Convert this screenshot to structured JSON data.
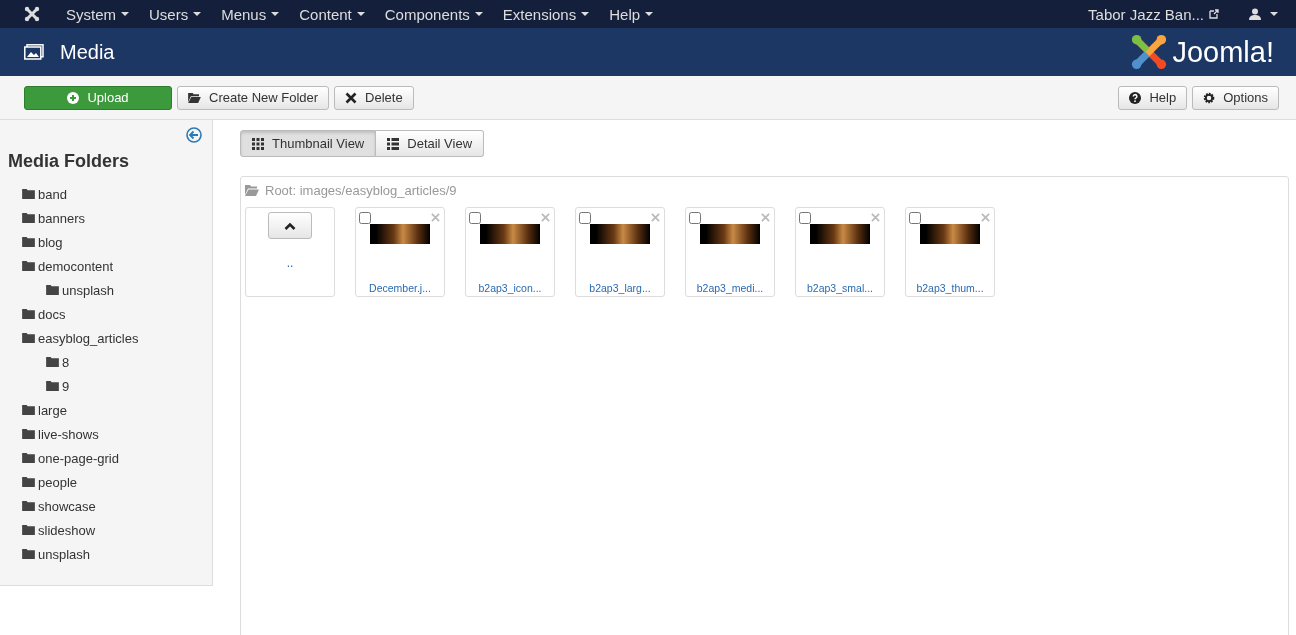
{
  "top_menu": [
    {
      "label": "System"
    },
    {
      "label": "Users"
    },
    {
      "label": "Menus"
    },
    {
      "label": "Content"
    },
    {
      "label": "Components"
    },
    {
      "label": "Extensions"
    },
    {
      "label": "Help"
    }
  ],
  "site_link": "Tabor Jazz Ban...",
  "header": {
    "title": "Media",
    "logo_text": "Joomla!"
  },
  "toolbar": {
    "left": [
      {
        "label": "Upload",
        "kind": "upload"
      },
      {
        "label": "Create New Folder",
        "kind": "folder"
      },
      {
        "label": "Delete",
        "kind": "delete"
      }
    ],
    "right": [
      {
        "label": "Help",
        "kind": "help"
      },
      {
        "label": "Options",
        "kind": "options"
      }
    ]
  },
  "sidebar": {
    "title": "Media Folders",
    "folders": [
      {
        "name": "band"
      },
      {
        "name": "banners"
      },
      {
        "name": "blog"
      },
      {
        "name": "democontent",
        "children": [
          {
            "name": "unsplash"
          }
        ]
      },
      {
        "name": "docs"
      },
      {
        "name": "easyblog_articles",
        "children": [
          {
            "name": "8"
          },
          {
            "name": "9"
          }
        ]
      },
      {
        "name": "large"
      },
      {
        "name": "live-shows"
      },
      {
        "name": "one-page-grid"
      },
      {
        "name": "people"
      },
      {
        "name": "showcase"
      },
      {
        "name": "slideshow"
      },
      {
        "name": "unsplash"
      }
    ]
  },
  "view_tabs": [
    {
      "label": "Thumbnail View",
      "kind": "grid",
      "selected": true
    },
    {
      "label": "Detail View",
      "kind": "list",
      "selected": false
    }
  ],
  "path": "Root: images/easyblog_articles/9",
  "up_label": "..",
  "files": [
    {
      "name": "December.j...",
      "checked": false
    },
    {
      "name": "b2ap3_icon...",
      "checked": false
    },
    {
      "name": "b2ap3_larg...",
      "checked": false
    },
    {
      "name": "b2ap3_medi...",
      "checked": false
    },
    {
      "name": "b2ap3_smal...",
      "checked": false
    },
    {
      "name": "b2ap3_thum...",
      "checked": false
    }
  ]
}
